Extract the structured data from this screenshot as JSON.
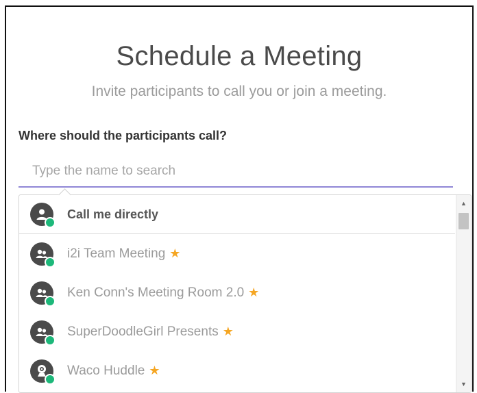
{
  "header": {
    "title": "Schedule a Meeting",
    "subtitle": "Invite participants to call you or join a meeting."
  },
  "form": {
    "question": "Where should the participants call?",
    "search_placeholder": "Type the name to search",
    "search_value": ""
  },
  "dropdown": {
    "items": [
      {
        "label": "Call me directly",
        "icon": "person-icon",
        "starred": false
      },
      {
        "label": "i2i Team Meeting",
        "icon": "group-icon",
        "starred": true
      },
      {
        "label": "Ken Conn's Meeting Room 2.0",
        "icon": "group-icon",
        "starred": true
      },
      {
        "label": "SuperDoodleGirl Presents",
        "icon": "group-icon",
        "starred": true
      },
      {
        "label": "Waco Huddle",
        "icon": "webcam-icon",
        "starred": true
      }
    ],
    "star_glyph": "★"
  },
  "colors": {
    "accent": "#8f86d6",
    "presence": "#1db87a",
    "star": "#f5a623",
    "avatar": "#4a4a4a"
  }
}
